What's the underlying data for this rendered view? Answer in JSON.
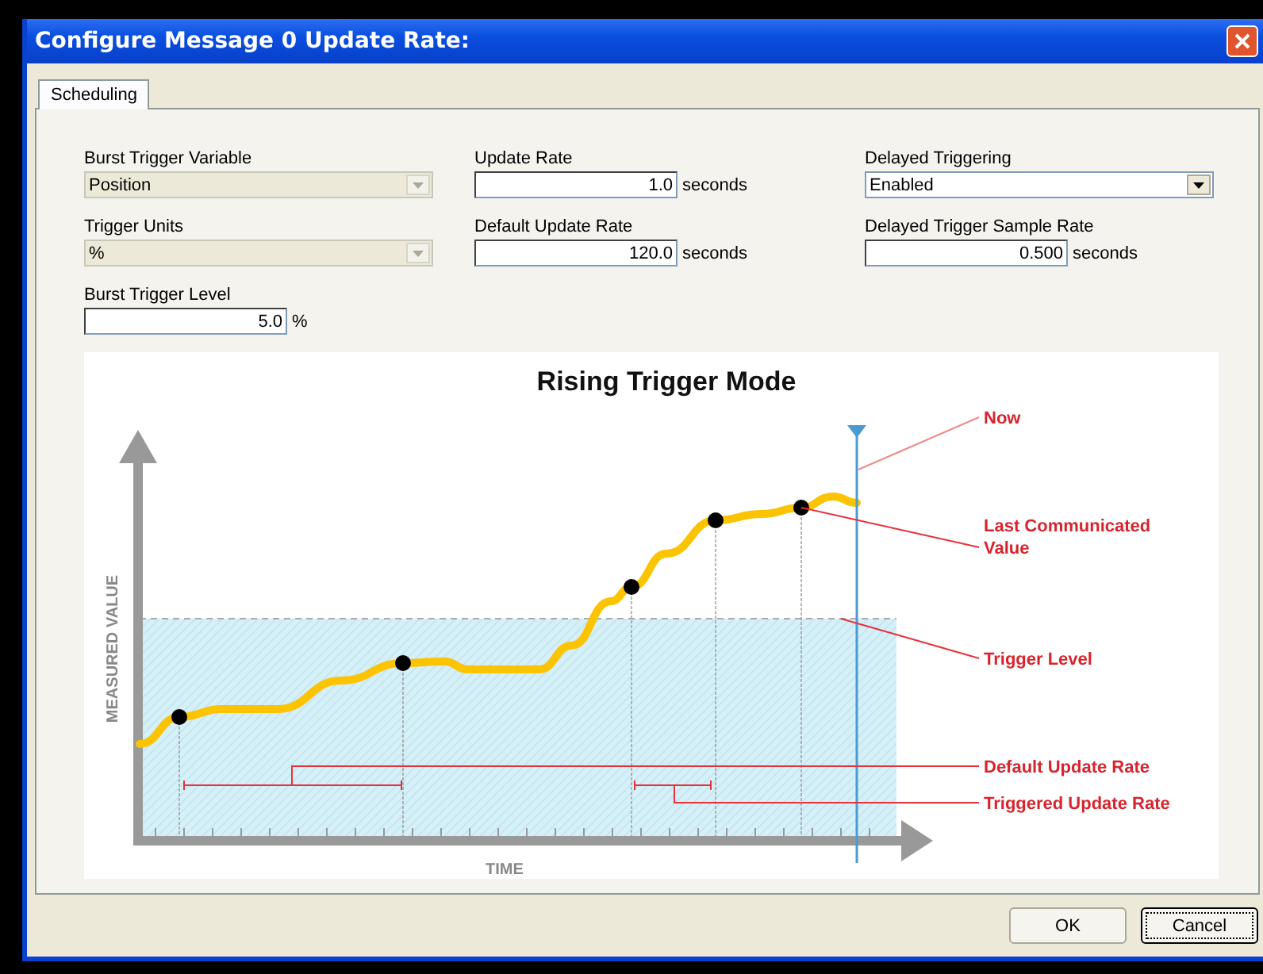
{
  "window": {
    "title": "Configure Message 0 Update Rate:"
  },
  "tabs": [
    {
      "label": "Scheduling",
      "selected": true
    }
  ],
  "columns": [
    [
      {
        "kind": "dropdown",
        "label": "Burst Trigger Variable",
        "value": "Position",
        "disabled": true
      },
      {
        "kind": "dropdown",
        "label": "Trigger Units",
        "value": "%",
        "disabled": true
      },
      {
        "kind": "number",
        "label": "Burst Trigger Level",
        "value": "5.0",
        "unit": "%"
      }
    ],
    [
      {
        "kind": "number",
        "label": "Update Rate",
        "value": "1.0",
        "unit": "seconds"
      },
      {
        "kind": "number",
        "label": "Default Update Rate",
        "value": "120.0",
        "unit": "seconds"
      }
    ],
    [
      {
        "kind": "dropdown",
        "label": "Delayed Triggering",
        "value": "Enabled",
        "disabled": false
      },
      {
        "kind": "number",
        "label": "Delayed Trigger Sample Rate",
        "value": "0.500",
        "unit": "seconds"
      }
    ]
  ],
  "diagram": {
    "title": "Rising Trigger Mode",
    "y_axis_label": "MEASURED VALUE",
    "x_axis_label": "TIME",
    "callouts": [
      [
        "Now"
      ],
      [
        "Last Communicated",
        "Value"
      ],
      [
        "Trigger Level"
      ],
      [
        "Default Update Rate"
      ],
      [
        "Triggered Update Rate"
      ]
    ]
  },
  "buttons": [
    {
      "label": "OK",
      "focused": false
    },
    {
      "label": "Cancel",
      "focused": true
    }
  ]
}
